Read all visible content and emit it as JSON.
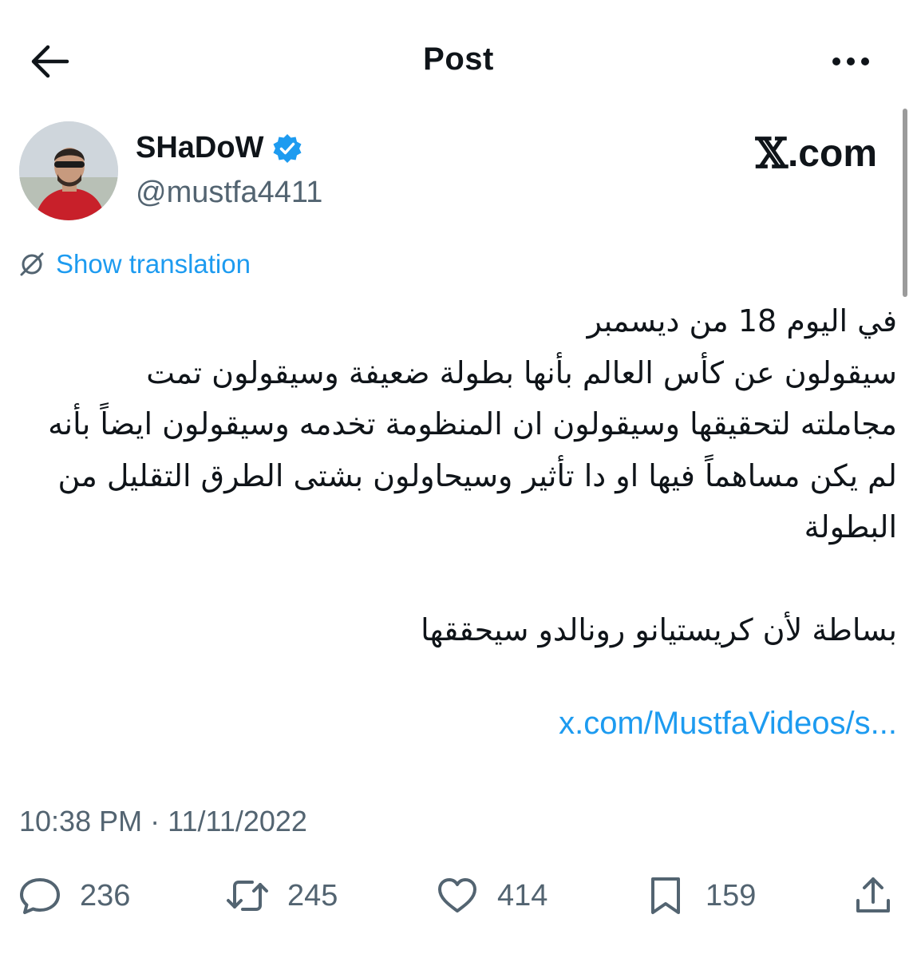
{
  "header": {
    "title": "Post"
  },
  "author": {
    "display_name": "SHaDoW",
    "handle": "@mustfa4411",
    "verified": true
  },
  "source_logo": {
    "glyph": "𝕏",
    "text": ".com"
  },
  "translation": {
    "label": "Show translation"
  },
  "tweet": {
    "text": "في اليوم 18 من ديسمبر\nسيقولون عن كأس العالم بأنها بطولة ضعيفة وسيقولون تمت مجاملته لتحقيقها وسيقولون ان المنظومة تخدمه وسيقولون ايضاً بأنه لم يكن مساهماً فيها او دا تأثير وسيحاولون بشتى الطرق التقليل من البطولة\n\nبساطة لأن كريستيانو رونالدو سيحققها",
    "link": "x.com/MustfaVideos/s..."
  },
  "meta": {
    "time": "10:38 PM",
    "separator": "·",
    "date": "11/11/2022"
  },
  "actions": {
    "replies": "236",
    "reposts": "245",
    "likes": "414",
    "bookmarks": "159"
  },
  "colors": {
    "accent": "#1d9bf0",
    "text": "#0f1419",
    "secondary": "#536471"
  }
}
